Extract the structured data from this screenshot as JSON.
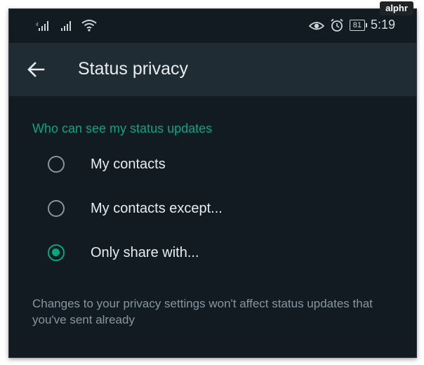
{
  "watermark": "alphr",
  "statusbar": {
    "battery": "81",
    "time": "5:19"
  },
  "toolbar": {
    "title": "Status privacy"
  },
  "section": {
    "header": "Who can see my status updates",
    "options": [
      {
        "label": "My contacts",
        "checked": false
      },
      {
        "label": "My contacts except...",
        "checked": false
      },
      {
        "label": "Only share with...",
        "checked": true
      }
    ],
    "note": "Changes to your privacy settings won't affect status updates that you've sent already"
  },
  "colors": {
    "accent": "#00a884",
    "background": "#121b22",
    "toolbar": "#1f2c34",
    "text": "#e9edef",
    "muted": "#8696a0"
  }
}
